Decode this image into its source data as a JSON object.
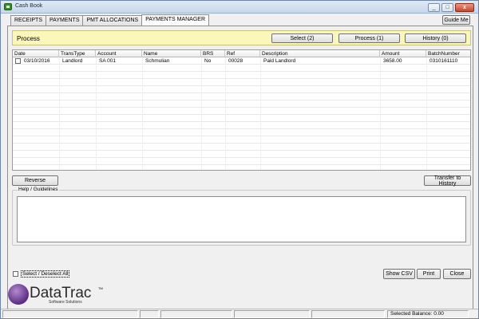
{
  "window": {
    "title": "Cash Book",
    "minimize_label": "_",
    "maximize_label": "□",
    "close_label": "x"
  },
  "tabs": [
    {
      "label": "RECEIPTS"
    },
    {
      "label": "PAYMENTS"
    },
    {
      "label": "PMT ALLOCATIONS"
    },
    {
      "label": "PAYMENTS MANAGER"
    }
  ],
  "guide_button": "Guide Me",
  "process": {
    "title": "Process",
    "select_label": "Select (2)",
    "process_label": "Process (1)",
    "history_label": "History (0)"
  },
  "grid": {
    "columns": [
      "Date",
      "TransType",
      "Account",
      "Name",
      "BRS",
      "Ref",
      "Description",
      "Amount",
      "BatchNumber"
    ],
    "rows": [
      {
        "date": "03/10/2016",
        "trans_type": "Landlord",
        "account": "SA 001",
        "name": "Schmulian",
        "brs": "No",
        "ref": "00028",
        "description": "Paid Landlord",
        "amount": "3658.00",
        "batch_number": "0310161110"
      }
    ]
  },
  "actions": {
    "reverse_label": "Reverse",
    "transfer_label": "Transfer to History"
  },
  "help": {
    "label": "Help / Guidelines",
    "value": ""
  },
  "select_all_label": "Select / Deselect All",
  "bottom_buttons": {
    "show_csv": "Show CSV",
    "print": "Print",
    "close": "Close"
  },
  "logo": {
    "name": "DataTrac",
    "tm": "TM",
    "subtitle": "Software Solutions"
  },
  "status": {
    "selected_balance": "Selected Balance: 0.00"
  },
  "colors": {
    "process_bar": "#fbf7ba",
    "logo_purple": "#5b2d84"
  }
}
